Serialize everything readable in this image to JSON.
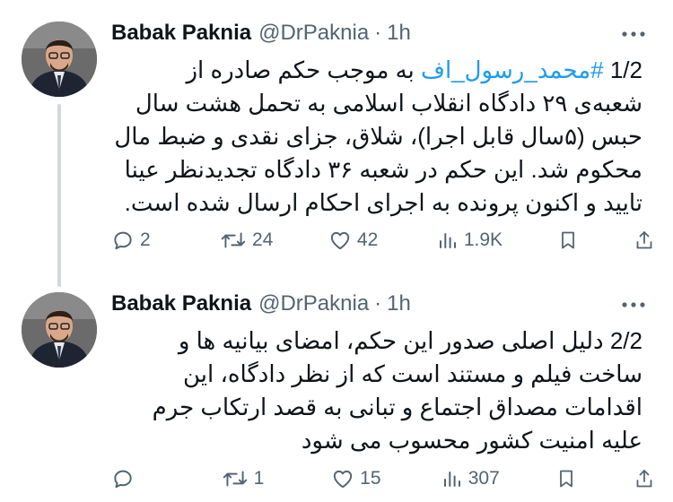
{
  "tweets": [
    {
      "author_name": "Babak Paknia",
      "handle": "@DrPaknia",
      "separator": "·",
      "time": "1h",
      "text_prefix": "1/2 ",
      "hashtag": "#محمد_رسول_اف",
      "text_rest": " به موجب حکم صادره از شعبه‌ی ۲۹ دادگاه انقلاب اسلامی به تحمل هشت سال حبس (۵سال قابل اجرا)، شلاق، جزای نقدی و ضبط مال محکوم شد. این حکم در شعبه ۳۶ دادگاه تجدیدنظر عینا تایید و اکنون پرونده به اجرای احکام ارسال شده است.",
      "replies": "2",
      "retweets": "24",
      "likes": "42",
      "views": "1.9K"
    },
    {
      "author_name": "Babak Paknia",
      "handle": "@DrPaknia",
      "separator": "·",
      "time": "1h",
      "text": "2/2 دلیل اصلی صدور این حکم، امضای بیانیه ها و ساخت فیلم و مستند است که از نظر دادگاه، این اقدامات مصداق اجتماع و تبانی به قصد ارتکاب جرم علیه امنیت کشور محسوب می شود",
      "replies": "",
      "retweets": "1",
      "likes": "15",
      "views": "307"
    }
  ],
  "icons": {
    "reply": "reply-icon",
    "retweet": "retweet-icon",
    "like": "heart-icon",
    "views": "views-icon",
    "bookmark": "bookmark-icon",
    "share": "share-icon",
    "more": "more-icon"
  },
  "colors": {
    "text": "#0f1419",
    "muted": "#536471",
    "link": "#1d9bf0",
    "thread_line": "#cfd9de"
  }
}
